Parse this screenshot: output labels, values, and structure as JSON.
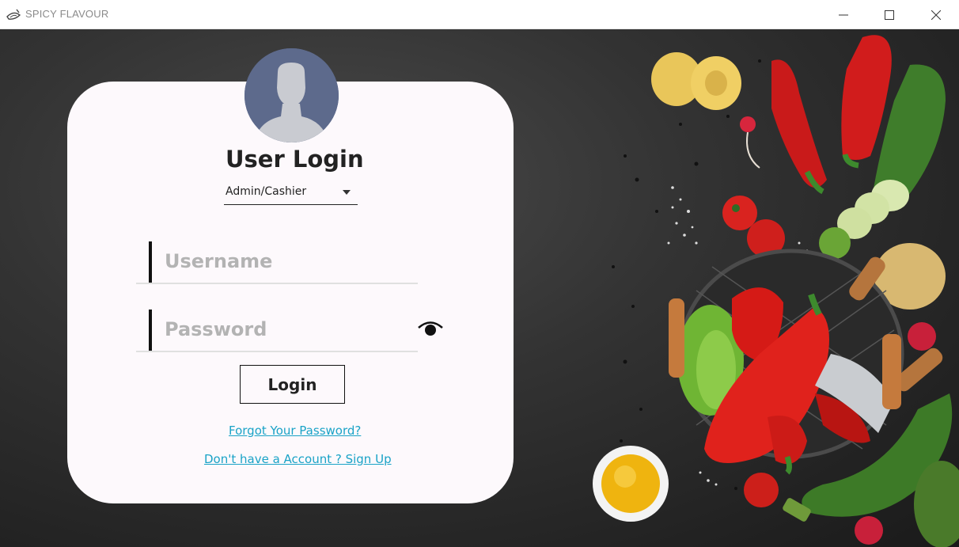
{
  "window": {
    "title": "SPICY FLAVOUR",
    "minimize_icon": "minimize-icon",
    "maximize_icon": "maximize-icon",
    "close_icon": "close-icon"
  },
  "login": {
    "title": "User Login",
    "role_selected": "Admin/Cashier",
    "username_placeholder": "Username",
    "password_placeholder": "Password",
    "button_label": "Login",
    "forgot_link": "Forgot Your Password?",
    "signup_link": "Don't have a Account ? Sign Up",
    "show_password_icon": "eye-icon",
    "avatar_icon": "user-avatar-icon"
  },
  "colors": {
    "card_bg": "#fdf9fc",
    "link": "#1aa3c7",
    "avatar_bg": "#5d6a8c",
    "background": "#2b2b2b"
  }
}
